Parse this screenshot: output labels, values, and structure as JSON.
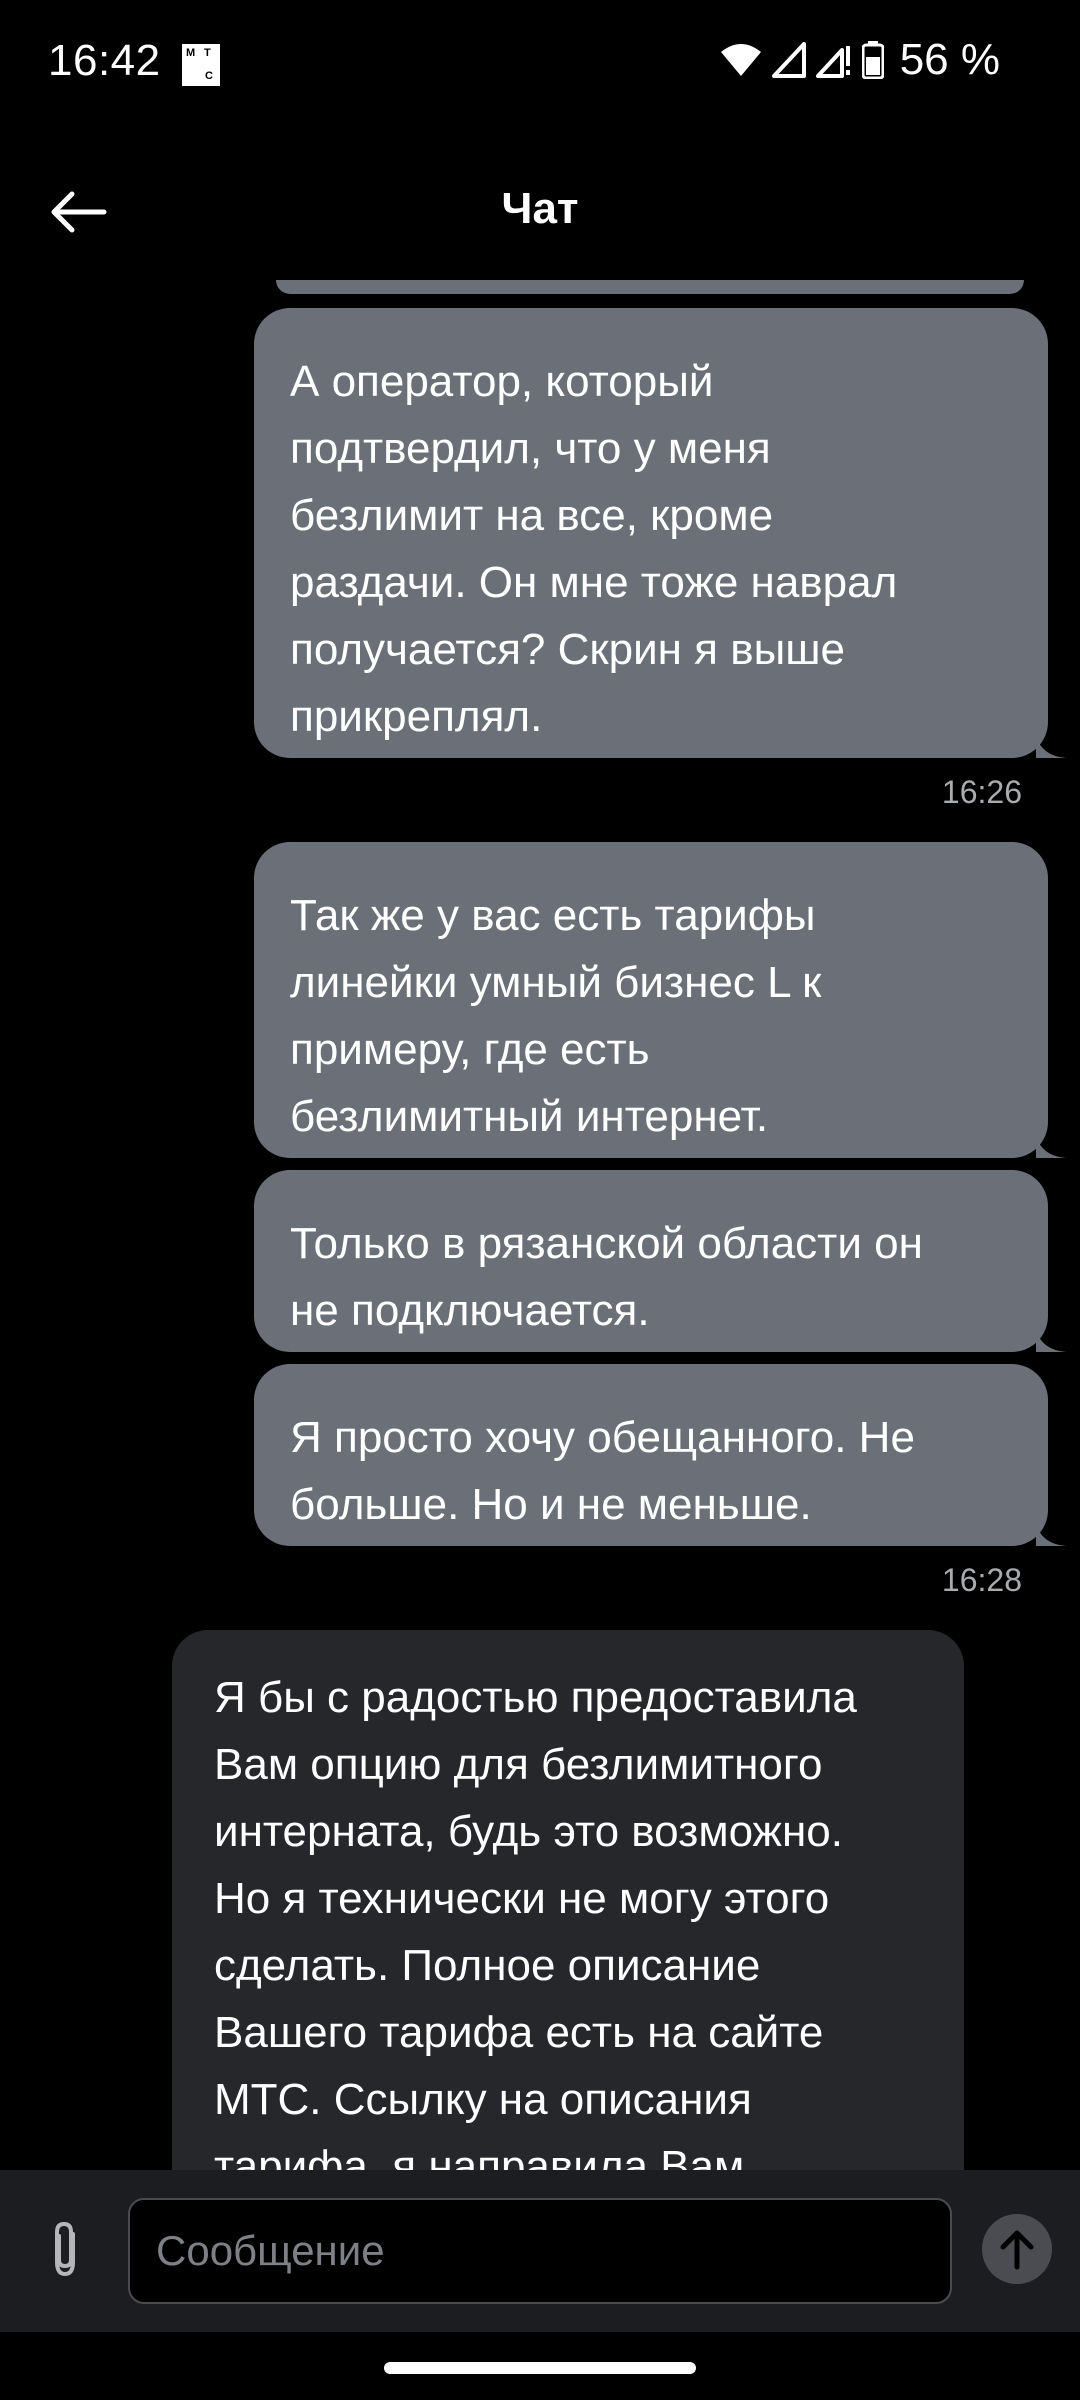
{
  "status_bar": {
    "time": "16:42",
    "carrier_icon": "mts-logo-icon",
    "battery": "56 %",
    "icons": [
      "wifi-icon",
      "signal-icon",
      "signal-no-service-icon",
      "battery-icon"
    ]
  },
  "header": {
    "title": "Чат",
    "back_icon": "arrow-left-icon"
  },
  "messages": [
    {
      "side": "out",
      "text": "А оператор, который\nподтвердил, что у меня\nбезлимит на все, кроме\nраздачи. Он мне тоже наврал\nполучается? Скрин я выше\nприкреплял."
    },
    {
      "time": "16:26"
    },
    {
      "side": "out",
      "text": "Так же у вас есть тарифы\nлинейки умный бизнес L к\nпримеру, где есть\nбезлимитный интернет."
    },
    {
      "side": "out",
      "text": "Только в рязанской области он\nне подключается."
    },
    {
      "side": "out",
      "text": "Я просто хочу обещанного. Не\nбольше. Но и не меньше."
    },
    {
      "time": "16:28"
    },
    {
      "side": "in",
      "text": "Я бы с радостью предоставила\nВам опцию для безлимитного\nинтерната, будь это возможно.\nНо я технически не могу этого\nсделать. Полное описание\nВашего тарифа есть на сайте\nМТС. Ссылку на описания\nтарифа, я направила Вам"
    }
  ],
  "input": {
    "placeholder": "Сообщение",
    "value": ""
  },
  "colors": {
    "background": "#000000",
    "outgoing_bubble": "#6b7078",
    "incoming_bubble": "#25272b",
    "input_bar": "#1c1d20",
    "timestamp": "#a8abb0"
  }
}
